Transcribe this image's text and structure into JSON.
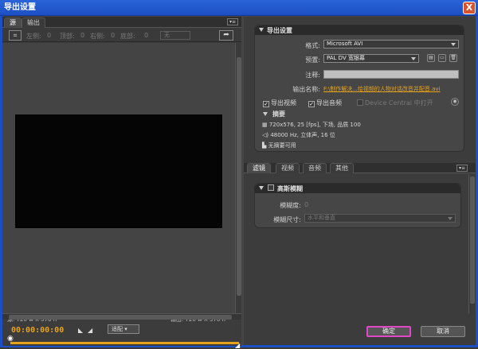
{
  "window": {
    "title": "导出设置",
    "close_glyph": "X"
  },
  "left": {
    "tabs": [
      "源",
      "输出"
    ],
    "panel_menu": "▾≡",
    "crop": {
      "labels": [
        "左侧:",
        "顶部:",
        "右侧:",
        "底部:"
      ],
      "values": [
        "0",
        "0",
        "0",
        "0"
      ],
      "preset": "无"
    },
    "source_info": "源: 720 w X 576 h",
    "output_info": "输出: 720 w X 576 h",
    "timecode": "00:00:00:00",
    "fit_label": "适配"
  },
  "export_settings": {
    "title": "导出设置",
    "format_label": "格式:",
    "format_value": "Microsoft AVI",
    "preset_label": "预置:",
    "preset_value": "PAL DV 宽银幕",
    "comment_label": "注释:",
    "output_name_label": "输出名称:",
    "output_name_value": "F:\\制作解决...给视频的人物对话改音并配音.avi",
    "export_video": "导出视频",
    "export_audio": "导出音频",
    "device_central": "Device Central 中打开",
    "summary_title": "摘要",
    "summary_lines": [
      "720x576, 25 [fps], 下场, 品质 100",
      "48000 Hz, 立体声, 16 位",
      "无摘要可用"
    ]
  },
  "right_tabs": [
    "滤镜",
    "视频",
    "音频",
    "其他"
  ],
  "filter": {
    "title": "高斯模糊",
    "blur_label": "模糊度:",
    "blur_value": "0",
    "dimension_label": "模糊尺寸:",
    "dimension_value": "水平和垂直"
  },
  "buttons": {
    "ok": "确定",
    "cancel": "取消"
  }
}
